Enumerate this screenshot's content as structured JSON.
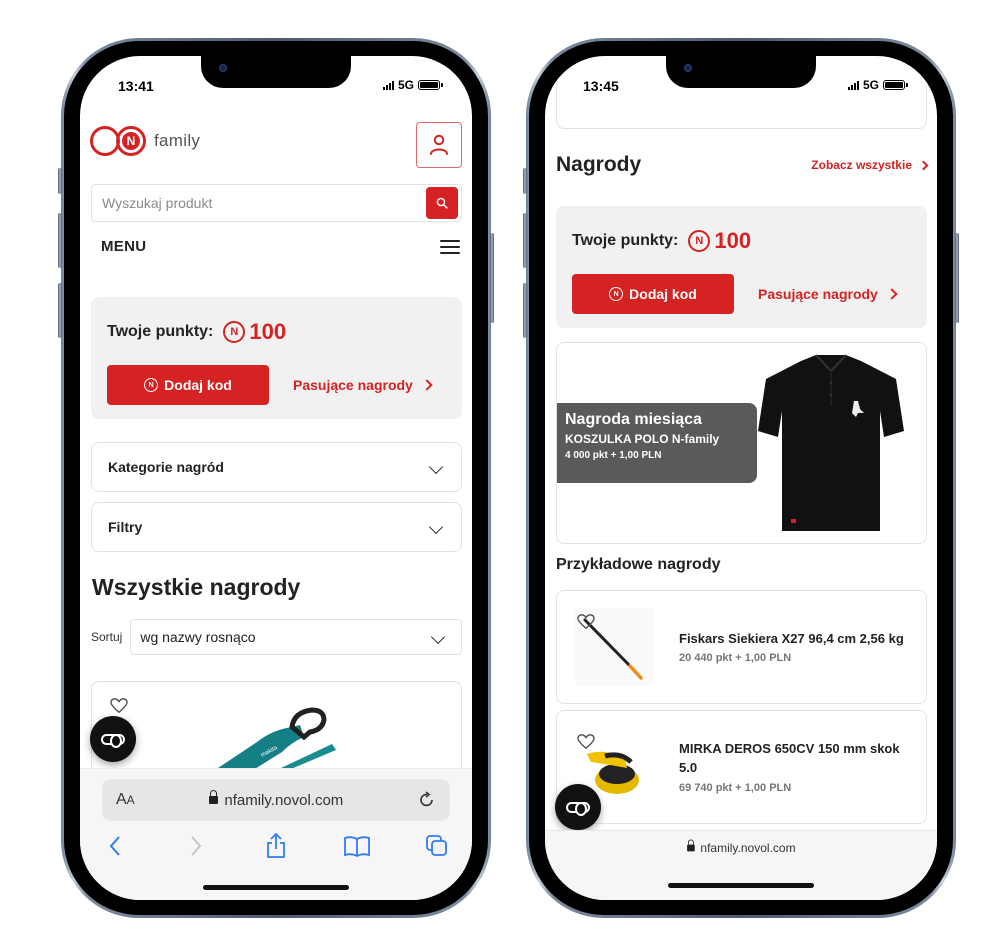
{
  "left_phone": {
    "status": {
      "time": "13:41",
      "network": "5G"
    },
    "header": {
      "logo_text": "family",
      "logo_letter": "N",
      "account_icon": "user-icon"
    },
    "search": {
      "placeholder": "Wyszukaj produkt",
      "value": "",
      "icon": "search-icon"
    },
    "menu": {
      "label": "MENU",
      "icon": "hamburger-icon"
    },
    "points": {
      "label": "Twoje punkty:",
      "value": "100",
      "coin_letter": "N",
      "add_code_label": "Dodaj kod",
      "matching_rewards_label": "Pasujące nagrody"
    },
    "accordions": [
      {
        "label": "Kategorie nagród"
      },
      {
        "label": "Filtry"
      }
    ],
    "section_title": "Wszystkie nagrody",
    "sort": {
      "label": "Sortuj",
      "selected": "wg nazwy rosnąco"
    },
    "browser": {
      "text_size_label": "A",
      "text_size_small": "A",
      "url": "nfamily.novol.com"
    }
  },
  "right_phone": {
    "status": {
      "time": "13:45",
      "network": "5G"
    },
    "rewards": {
      "title": "Nagrody",
      "see_all_label": "Zobacz wszystkie"
    },
    "points": {
      "label": "Twoje punkty:",
      "value": "100",
      "coin_letter": "N",
      "add_code_label": "Dodaj kod",
      "matching_rewards_label": "Pasujące nagrody"
    },
    "reward_of_month": {
      "heading": "Nagroda miesiąca",
      "product": "KOSZULKA POLO N-family",
      "price": "4 000 pkt + 1,00 PLN"
    },
    "examples_title": "Przykładowe nagrody",
    "examples": [
      {
        "name": "Fiskars Siekiera X27 96,4 cm 2,56 kg",
        "price": "20 440 pkt + 1,00 PLN"
      },
      {
        "name": "MIRKA DEROS 650CV 150 mm skok 5.0",
        "price": "69 740 pkt + 1,00 PLN"
      }
    ],
    "browser": {
      "url": "nfamily.novol.com"
    }
  },
  "colors": {
    "accent": "#d52222",
    "card_bg": "#f1f1f1",
    "badge_bg": "#5a5a5a",
    "link_blue": "#2f7cf6"
  }
}
